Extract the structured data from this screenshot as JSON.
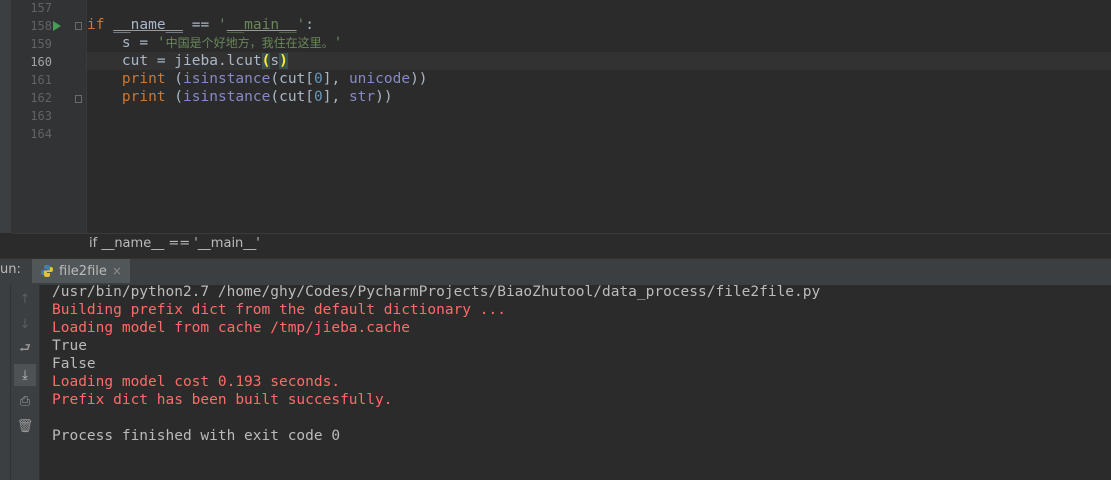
{
  "editor": {
    "line_numbers": [
      "157",
      "158",
      "159",
      "160",
      "161",
      "162",
      "163",
      "164"
    ],
    "current_line": "160",
    "code": {
      "l158": {
        "kw": "if",
        "name_part": "__name__",
        "op": " == ",
        "str_q1": "'",
        "main_str": "__main__",
        "str_q2": "'",
        "colon": ":"
      },
      "l159": {
        "lhs": "    s = ",
        "str_open": "'",
        "str_cjk": "中国是个好地方，我住在这里。",
        "str_close": "'"
      },
      "l160": {
        "lhs": "    cut = jieba.lcut",
        "paren_open": "(",
        "arg": "s",
        "paren_close": ")"
      },
      "l161": {
        "indent": "    ",
        "fn": "print",
        "a": " (",
        "b": "isinstance",
        "c": "(cut[",
        "n": "0",
        "d": "], ",
        "e": "unicode",
        "f": "))"
      },
      "l162": {
        "indent": "    ",
        "fn": "print",
        "a": " (",
        "b": "isinstance",
        "c": "(cut[",
        "n": "0",
        "d": "], ",
        "e": "str",
        "f": "))"
      }
    },
    "breadcrumb": "if __name__ == '__main__'"
  },
  "run_panel": {
    "label": "un:",
    "tab_label": "file2file",
    "tab_close": "×"
  },
  "toolbar": {
    "up_icon": "↑",
    "down_icon": "↓",
    "wrap_icon": "⮐",
    "scroll_end_icon": "⤓",
    "print_icon": "⎙",
    "trash_icon": "🗑"
  },
  "console": {
    "lines": [
      {
        "text": "/usr/bin/python2.7 /home/ghy/Codes/PycharmProjects/BiaoZhutool/data_process/file2file.py",
        "type": "normal"
      },
      {
        "text": "Building prefix dict from the default dictionary ...",
        "type": "err"
      },
      {
        "text": "Loading model from cache /tmp/jieba.cache",
        "type": "err"
      },
      {
        "text": "True",
        "type": "normal"
      },
      {
        "text": "False",
        "type": "normal"
      },
      {
        "text": "Loading model cost 0.193 seconds.",
        "type": "err"
      },
      {
        "text": "Prefix dict has been built succesfully.",
        "type": "err"
      },
      {
        "text": "",
        "type": "normal"
      },
      {
        "text": "Process finished with exit code 0",
        "type": "normal"
      }
    ]
  },
  "colors": {
    "background": "#2b2b2b",
    "keyword": "#cc7832",
    "string": "#6a8759",
    "number": "#6897bb",
    "builtin": "#8888c6",
    "stderr": "#ff6b68",
    "stdout": "#bbbbbb",
    "run_arrow": "#499c54"
  }
}
